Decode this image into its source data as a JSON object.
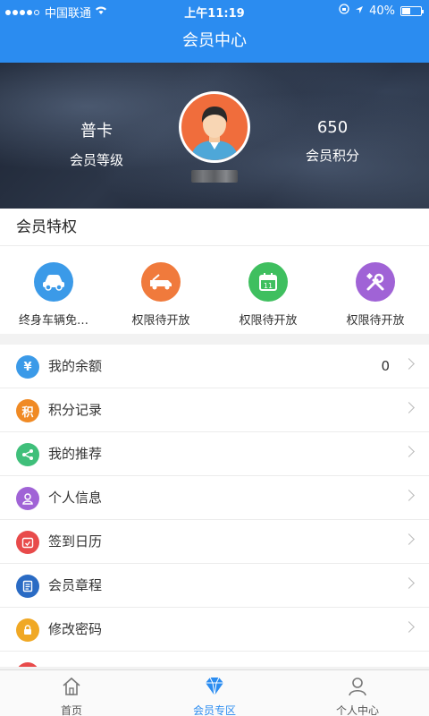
{
  "status": {
    "carrier": "中国联通",
    "time": "上午11:19",
    "battery": "40%"
  },
  "nav": {
    "title": "会员中心"
  },
  "hero": {
    "level_value": "普卡",
    "level_label": "会员等级",
    "points_value": "650",
    "points_label": "会员积分"
  },
  "privileges": {
    "title": "会员特权",
    "items": [
      {
        "label": "终身车辆免…",
        "icon": "car-icon",
        "color": "#3b9ae8"
      },
      {
        "label": "权限待开放",
        "icon": "tow-truck-icon",
        "color": "#f07a3c"
      },
      {
        "label": "权限待开放",
        "icon": "calendar-icon",
        "color": "#3fbf5f"
      },
      {
        "label": "权限待开放",
        "icon": "tools-icon",
        "color": "#a063d6"
      }
    ]
  },
  "menu": [
    {
      "label": "我的余额",
      "value": "0",
      "icon": "yen-icon",
      "color": "#3b9ae8",
      "glyph": "¥"
    },
    {
      "label": "积分记录",
      "value": "",
      "icon": "points-icon",
      "color": "#f08a24",
      "glyph": "积"
    },
    {
      "label": "我的推荐",
      "value": "",
      "icon": "share-icon",
      "color": "#3fbf7a",
      "glyph": ""
    },
    {
      "label": "个人信息",
      "value": "",
      "icon": "user-icon",
      "color": "#a063d6",
      "glyph": ""
    },
    {
      "label": "签到日历",
      "value": "",
      "icon": "calendar-check-icon",
      "color": "#e84a4a",
      "glyph": ""
    },
    {
      "label": "会员章程",
      "value": "",
      "icon": "document-icon",
      "color": "#2a6bc4",
      "glyph": ""
    },
    {
      "label": "修改密码",
      "value": "",
      "icon": "lock-icon",
      "color": "#f0a824",
      "glyph": ""
    }
  ],
  "tabs": [
    {
      "label": "首页",
      "icon": "home-icon"
    },
    {
      "label": "会员专区",
      "icon": "diamond-icon"
    },
    {
      "label": "个人中心",
      "icon": "person-icon"
    }
  ],
  "colors": {
    "primary": "#2b8cf0"
  }
}
